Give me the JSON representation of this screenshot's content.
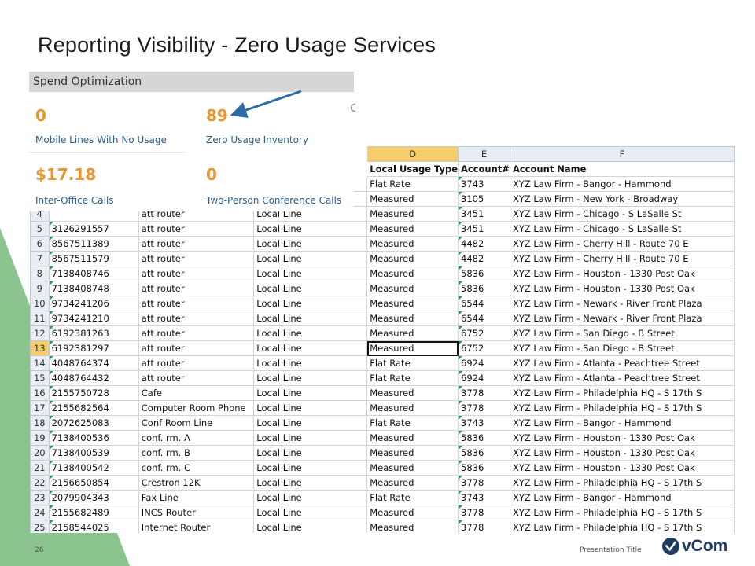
{
  "slide": {
    "title": "Reporting Visibility - Zero Usage Services",
    "page_number": "26",
    "footer_title": "Presentation Title",
    "brand": "vCom"
  },
  "panel": {
    "header": "Spend Optimization",
    "tiles": [
      {
        "value": "0",
        "label": "Mobile Lines With No Usage"
      },
      {
        "value": "89",
        "label": "Zero Usage Inventory"
      },
      {
        "value": "$17.18",
        "label": "Inter-Office Calls"
      },
      {
        "value": "0",
        "label": "Two-Person Conference Calls"
      }
    ]
  },
  "sheet": {
    "columns": [
      "D",
      "E",
      "F"
    ],
    "headers": [
      "Local Usage Type",
      "Account#",
      "Account Name"
    ],
    "rows": [
      {
        "n": "",
        "a": "",
        "b": "",
        "c": "",
        "d": "Flat Rate",
        "e": "3743",
        "f": "XYZ Law Firm - Bangor - Hammond"
      },
      {
        "n": "",
        "a": "",
        "b": "",
        "c": "",
        "d": "Measured",
        "e": "3105",
        "f": "XYZ Law Firm - New York - Broadway"
      },
      {
        "n": "4",
        "a": "",
        "b": "att router",
        "c": "Local Line",
        "d": "Measured",
        "e": "3451",
        "f": "XYZ Law Firm - Chicago - S LaSalle St"
      },
      {
        "n": "5",
        "a": "3126291557",
        "b": "att router",
        "c": "Local Line",
        "d": "Measured",
        "e": "3451",
        "f": "XYZ Law Firm - Chicago - S LaSalle St"
      },
      {
        "n": "6",
        "a": "8567511389",
        "b": "att router",
        "c": "Local Line",
        "d": "Measured",
        "e": "4482",
        "f": "XYZ Law Firm - Cherry Hill - Route 70 E"
      },
      {
        "n": "7",
        "a": "8567511579",
        "b": "att router",
        "c": "Local Line",
        "d": "Measured",
        "e": "4482",
        "f": "XYZ Law Firm - Cherry Hill - Route 70 E"
      },
      {
        "n": "8",
        "a": "7138408746",
        "b": "att router",
        "c": "Local Line",
        "d": "Measured",
        "e": "5836",
        "f": "XYZ Law Firm - Houston - 1330 Post Oak"
      },
      {
        "n": "9",
        "a": "7138408748",
        "b": "att router",
        "c": "Local Line",
        "d": "Measured",
        "e": "5836",
        "f": "XYZ Law Firm - Houston - 1330 Post Oak"
      },
      {
        "n": "10",
        "a": "9734241206",
        "b": "att router",
        "c": "Local Line",
        "d": "Measured",
        "e": "6544",
        "f": "XYZ Law Firm - Newark - River Front Plaza"
      },
      {
        "n": "11",
        "a": "9734241210",
        "b": "att router",
        "c": "Local Line",
        "d": "Measured",
        "e": "6544",
        "f": "XYZ Law Firm - Newark - River Front Plaza"
      },
      {
        "n": "12",
        "a": "6192381263",
        "b": "att router",
        "c": "Local Line",
        "d": "Measured",
        "e": "6752",
        "f": "XYZ Law Firm - San Diego - B Street"
      },
      {
        "n": "13",
        "a": "6192381297",
        "b": "att router",
        "c": "Local Line",
        "d": "Measured",
        "e": "6752",
        "f": "XYZ Law Firm - San Diego - B Street"
      },
      {
        "n": "14",
        "a": "4048764374",
        "b": "att router",
        "c": "Local Line",
        "d": "Flat Rate",
        "e": "6924",
        "f": "XYZ Law Firm - Atlanta - Peachtree Street"
      },
      {
        "n": "15",
        "a": "4048764432",
        "b": "att router",
        "c": "Local Line",
        "d": "Flat Rate",
        "e": "6924",
        "f": "XYZ Law Firm - Atlanta - Peachtree Street"
      },
      {
        "n": "16",
        "a": "2155750728",
        "b": "Cafe",
        "c": "Local Line",
        "d": "Measured",
        "e": "3778",
        "f": "XYZ Law Firm - Philadelphia HQ - S 17th S"
      },
      {
        "n": "17",
        "a": "2155682564",
        "b": "Computer Room Phone",
        "c": "Local Line",
        "d": "Measured",
        "e": "3778",
        "f": "XYZ Law Firm - Philadelphia HQ - S 17th S"
      },
      {
        "n": "18",
        "a": "2072625083",
        "b": "Conf Room Line",
        "c": "Local Line",
        "d": "Flat Rate",
        "e": "3743",
        "f": "XYZ Law Firm - Bangor - Hammond"
      },
      {
        "n": "19",
        "a": "7138400536",
        "b": "conf. rm. A",
        "c": "Local Line",
        "d": "Measured",
        "e": "5836",
        "f": "XYZ Law Firm - Houston - 1330 Post Oak"
      },
      {
        "n": "20",
        "a": "7138400539",
        "b": "conf. rm. B",
        "c": "Local Line",
        "d": "Measured",
        "e": "5836",
        "f": "XYZ Law Firm - Houston - 1330 Post Oak"
      },
      {
        "n": "21",
        "a": "7138400542",
        "b": "conf. rm. C",
        "c": "Local Line",
        "d": "Measured",
        "e": "5836",
        "f": "XYZ Law Firm - Houston - 1330 Post Oak"
      },
      {
        "n": "22",
        "a": "2156650854",
        "b": "Crestron 12K",
        "c": "Local Line",
        "d": "Measured",
        "e": "3778",
        "f": "XYZ Law Firm - Philadelphia HQ - S 17th S"
      },
      {
        "n": "23",
        "a": "2079904343",
        "b": "Fax Line",
        "c": "Local Line",
        "d": "Flat Rate",
        "e": "3743",
        "f": "XYZ Law Firm - Bangor - Hammond"
      },
      {
        "n": "24",
        "a": "2155682489",
        "b": "INCS Router",
        "c": "Local Line",
        "d": "Measured",
        "e": "3778",
        "f": "XYZ Law Firm - Philadelphia HQ - S 17th S"
      },
      {
        "n": "25",
        "a": "2158544025",
        "b": "Internet Router",
        "c": "Local Line",
        "d": "Measured",
        "e": "3778",
        "f": "XYZ Law Firm - Philadelphia HQ - S 17th S"
      }
    ],
    "selected_row": "13",
    "selected_column": "D",
    "active_cell_value": "Measured"
  },
  "colors": {
    "accent_green": "#8cc490",
    "tile_value_orange": "#e8962e",
    "tile_label_blue": "#2e5d8a",
    "arrow_blue": "#2e6da4",
    "brand_navy": "#1f3b64"
  },
  "icons": {
    "arrow": "arrow-pointer-icon",
    "brand_mark": "vcom-check-icon"
  }
}
